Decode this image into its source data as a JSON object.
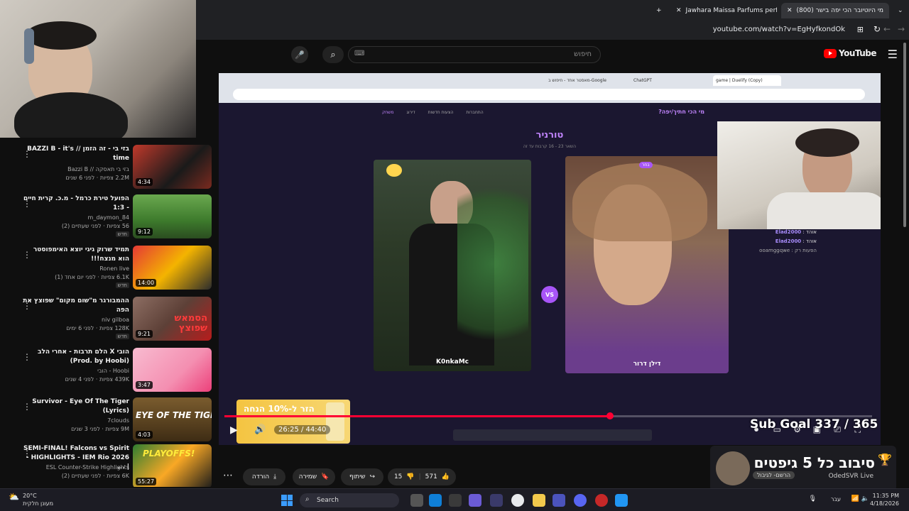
{
  "browser": {
    "tabs": [
      {
        "label": "(800) מי היוטיובר הכי יפה בישר",
        "active": true
      },
      {
        "label": "Jawhara Maissa Parfums perfum",
        "active": false
      }
    ],
    "url": "youtube.com/watch?v=EgHyfkondOk"
  },
  "youtube": {
    "logo_text": "YouTube",
    "search_placeholder": "חיפוש"
  },
  "sidebar": {
    "videos": [
      {
        "title": "בזי בי - זה הזמן // BAZZI B - it's time",
        "channel": "בזי בי תאסקה // Bazzi B",
        "meta": "2.2M צפיות · לפני 6 שנים",
        "duration": "4:34",
        "badge": ""
      },
      {
        "title": "הפועל טירת כרמל - מ.כ. קרית חיים - 1:3",
        "channel": "m_daymon_84",
        "meta": "56 צפיות · לפני שעתיים (2)",
        "duration": "9:12",
        "badge": "חדש"
      },
      {
        "title": "תמיד שרוק גיגי יוצא האימפוסטר הוא מנצח!!!",
        "channel": "Ronen live",
        "meta": "6.1K צפיות · לפני יום אחד (1)",
        "duration": "14:00",
        "badge": "חדש"
      },
      {
        "title": "ההמבורגר מ\"שום מקום\" שפוצץ את הפה",
        "channel": "niv gilboa",
        "meta": "128K צפיות · לפני 6 ימים",
        "duration": "9:21",
        "badge": "חדש"
      },
      {
        "title": "הובי X הלם תרבות - אחרי הלב (Prod. by Hoobi)",
        "channel": "Hoobi - הובי",
        "meta": "439K צפיות · לפני 4 שנים",
        "duration": "3:47",
        "badge": ""
      },
      {
        "title": "Survivor - Eye Of The Tiger (Lyrics)",
        "channel": "7clouds",
        "meta": "9M צפיות · לפני 3 שנים",
        "duration": "4:03",
        "badge": ""
      },
      {
        "title": "SEMI-FINAL! Falcons vs Spirit - HIGHLIGHTS - IEM Rio 2026 | ...",
        "channel": "ESL Counter-Strike Highlights",
        "meta": "6K צפיות · לפני שעתיים (2)",
        "duration": "55:27",
        "badge": ""
      }
    ],
    "thumb_texts": [
      "",
      "",
      "",
      "הסמאש שפוצץ",
      "",
      "EYE OF THE TIGER",
      "PLAYOFFS!"
    ]
  },
  "player": {
    "inner_tabs": [
      "game | Duelify (Copy)",
      "ChatGPT",
      "מאסטר אחד - חיפוש ב-Google"
    ],
    "page_title": "מי הכי חתיך/יפה?",
    "nav": [
      "משחק",
      "דירוג",
      "הצעות חדשות",
      "התחברות"
    ],
    "tournament_title": "טורניר",
    "tournament_sub": "השאר 23 - 16 קרבות עד זה",
    "left_name": "K0nkaMc",
    "right_name": "דילן דרור",
    "right_badge": "בחר",
    "vs": "VS",
    "chat": [
      {
        "user": "Elad2000",
        "text": "אוהד :"
      },
      {
        "user": "Elad2000",
        "text": "אוהד :"
      },
      {
        "user": "",
        "text": "הפעות רק : ooamggqwe"
      }
    ],
    "timecode": "26:25 / 44:40",
    "progress": 0.595,
    "ad_text": "הזר ל-10% הנחה",
    "sub_goal": "Sub Goal 337 / 365",
    "gift_title": "סיבוב כל 5 גיפטים",
    "gift_streamer": "OdedSVR Live",
    "gift_sub": "הרשם- לגיבול"
  },
  "actions": {
    "likes": "571",
    "dislikes": "15",
    "share": "שיתוף",
    "save": "שמירה",
    "download": "הורדה"
  },
  "taskbar": {
    "temp": "20°C",
    "weather": "מעונן חלקית",
    "search": "Search",
    "lang": "עבר",
    "time": "11:35 PM",
    "date": "4/18/2026"
  },
  "colors": {
    "accent": "#ff0033",
    "purple": "#a855f7"
  }
}
